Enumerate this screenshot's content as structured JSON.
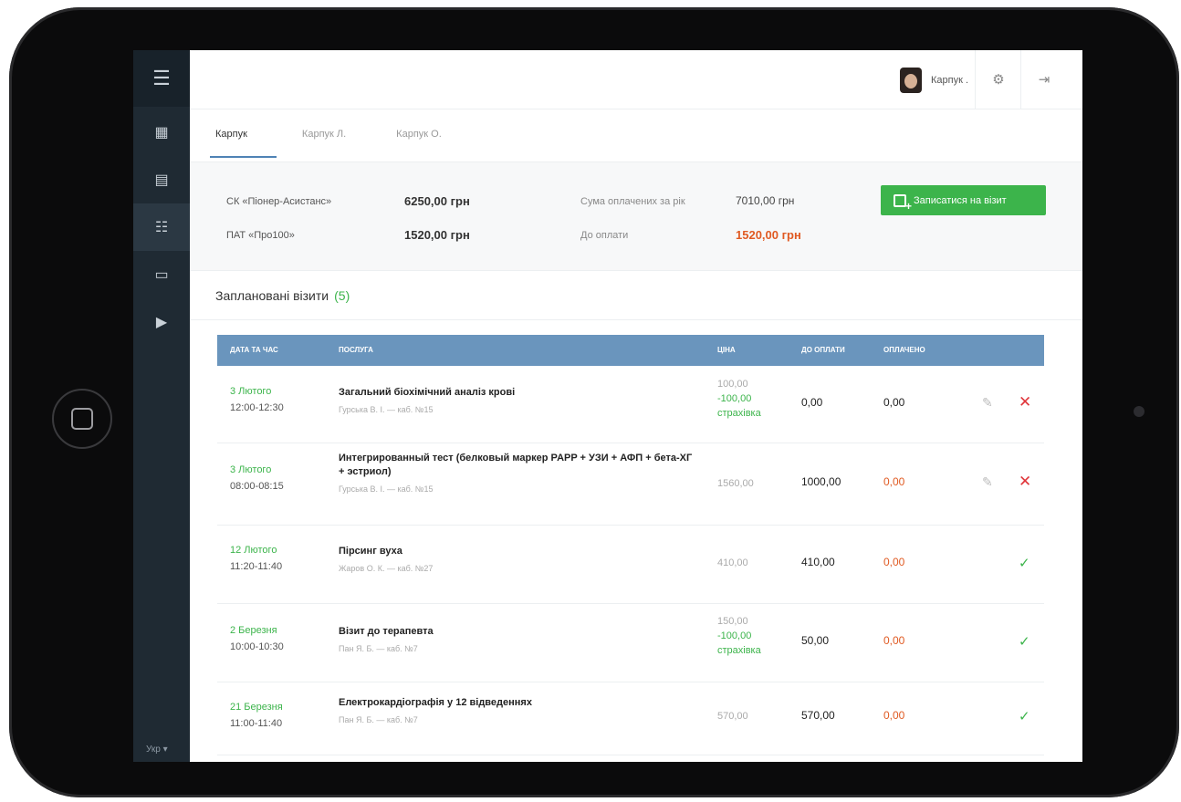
{
  "sidebar": {
    "icons": [
      "menu-icon",
      "dashboard-icon",
      "document-icon",
      "list-icon",
      "calendar-icon",
      "ticket-icon"
    ],
    "lang": "Укр ▾"
  },
  "header": {
    "user_name": "Карпук .",
    "settings_icon": "gear-icon",
    "logout_icon": "logout-icon"
  },
  "tabs": [
    {
      "label": "Карпук",
      "active": true
    },
    {
      "label": "Карпук Л."
    },
    {
      "label": "Карпук О."
    }
  ],
  "summary": {
    "insurer1": {
      "label": "СК «Піонер-Асистанс»",
      "value": "6250,00 грн"
    },
    "insurer2": {
      "label": "ПАТ «Про100»",
      "value": "1520,00 грн"
    },
    "total": {
      "label": "Сума оплачених за рік",
      "value": "7010,00 грн"
    },
    "due": {
      "label": "До оплати",
      "value": "1520,00 грн"
    },
    "button": "Записатися на візит"
  },
  "visits": {
    "title": "Заплановані візити",
    "count": "(5)",
    "columns": [
      "Дата та час",
      "Послуга",
      "Ціна",
      "До оплати",
      "Оплачено"
    ],
    "rows": [
      {
        "date": "3 Лютого",
        "time": "12:00-12:30",
        "service": "Загальний біохімічний аналіз крові",
        "doctor": "Гурська В. І. — каб. №15",
        "price": "100,00",
        "discount": "-100,00",
        "insurance": "страхівка",
        "due": "0,00",
        "paid": "0,00",
        "status": "edit"
      },
      {
        "date": "3 Лютого",
        "time": "08:00-08:15",
        "service": "Интегрированный тест (белковый маркер PAPP + УЗИ + АФП + бета-ХГ + эстриол)",
        "doctor": "Гурська В. І. — каб. №15",
        "price": "1560,00",
        "due": "1000,00",
        "paid": "0,00",
        "status": "edit"
      },
      {
        "date": "12 Лютого",
        "time": "11:20-11:40",
        "service": "Пірсинг вуха",
        "doctor": "Жаров О. К. — каб. №27",
        "price": "410,00",
        "due": "410,00",
        "paid": "0,00",
        "status": "done"
      },
      {
        "date": "2 Березня",
        "time": "10:00-10:30",
        "service": "Візит до терапевта",
        "doctor": "Пан Я. Б. — каб. №7",
        "price": "150,00",
        "discount": "-100,00",
        "insurance": "страхівка",
        "due": "50,00",
        "paid": "0,00",
        "status": "done"
      },
      {
        "date": "21 Березня",
        "time": "11:00-11:40",
        "service": "Електрокардіографія у 12 відведеннях",
        "doctor": "Пан Я. Б. — каб. №7",
        "price": "570,00",
        "due": "570,00",
        "paid": "0,00",
        "status": "done"
      }
    ]
  },
  "colors": {
    "accent_green": "#3cb44b",
    "header_blue": "#6a95bd",
    "sidebar": "#1f2a33",
    "alert_red": "#e05a22"
  }
}
